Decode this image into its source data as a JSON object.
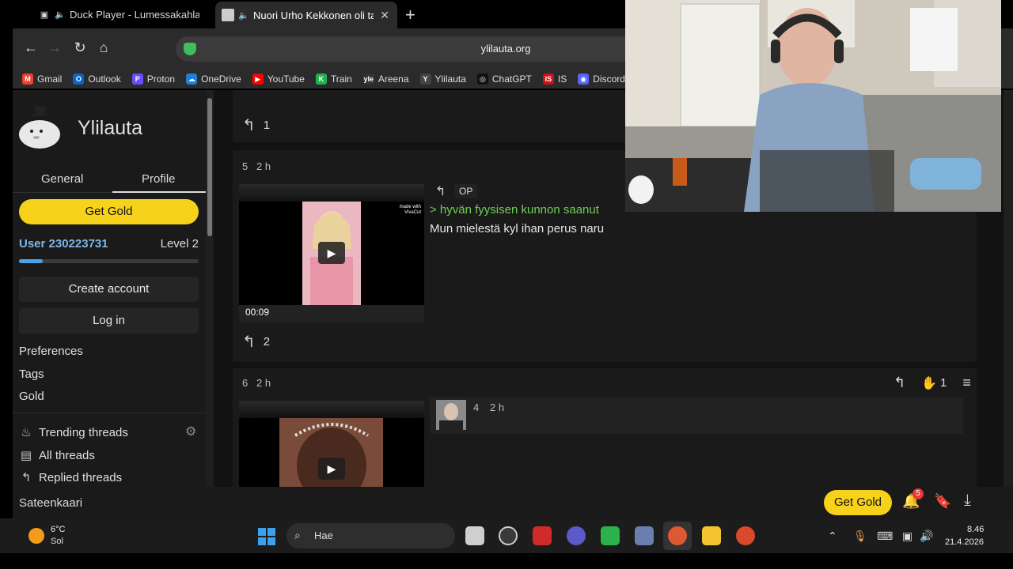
{
  "tabs": [
    {
      "title": "Duck Player - Lumessakahlaajat"
    },
    {
      "title": "Nuori Urho Kekkonen oli ta"
    }
  ],
  "toolbar": {
    "url": "ylilauta.org"
  },
  "bookmarks": [
    {
      "label": "Gmail",
      "color": "#ea4335",
      "glyph": "M"
    },
    {
      "label": "Outlook",
      "color": "#0a64c8",
      "glyph": "O"
    },
    {
      "label": "Proton",
      "color": "#6d4aff",
      "glyph": "P"
    },
    {
      "label": "OneDrive",
      "color": "#1f7fd8",
      "glyph": "☁"
    },
    {
      "label": "YouTube",
      "color": "#ff0000",
      "glyph": "▶"
    },
    {
      "label": "Train",
      "color": "#1fb34f",
      "glyph": "K"
    },
    {
      "label": "Areena",
      "color": "#333333",
      "glyph": "yle"
    },
    {
      "label": "Ylilauta",
      "color": "#444444",
      "glyph": "Y"
    },
    {
      "label": "ChatGPT",
      "color": "#111111",
      "glyph": "◎"
    },
    {
      "label": "IS",
      "color": "#d0101a",
      "glyph": "IS"
    },
    {
      "label": "Discord",
      "color": "#5865f2",
      "glyph": "◉"
    }
  ],
  "sidebar": {
    "site_name": "Ylilauta",
    "tab_general": "General",
    "tab_profile": "Profile",
    "get_gold": "Get Gold",
    "user": "User 230223731",
    "level": "Level 2",
    "progress": 0.13,
    "create_account": "Create account",
    "log_in": "Log in",
    "preferences": "Preferences",
    "tags": "Tags",
    "gold": "Gold",
    "trending": "Trending threads",
    "all_threads": "All threads",
    "replied": "Replied threads",
    "footer": "Sateenkaari"
  },
  "posts": {
    "top_reply_count": "1",
    "p5": {
      "number": "5",
      "age": "2 h",
      "duration": "00:09",
      "watermark": "made with VivaCut",
      "op": "OP",
      "greentext": "> hyvän fyysisen kunnon saanut",
      "text": "Mun mielestä kyl ihan perus naru",
      "replies": "2"
    },
    "p6": {
      "number": "6",
      "age": "2 h",
      "likes": "1",
      "quote_number": "4",
      "quote_age": "2 h"
    }
  },
  "bottom": {
    "get_gold": "Get Gold",
    "notifications": "5"
  },
  "taskbar": {
    "temp": "6°C",
    "condition": "Sol",
    "search": "Hae",
    "time": "8.46",
    "date": "21.4.2026"
  }
}
